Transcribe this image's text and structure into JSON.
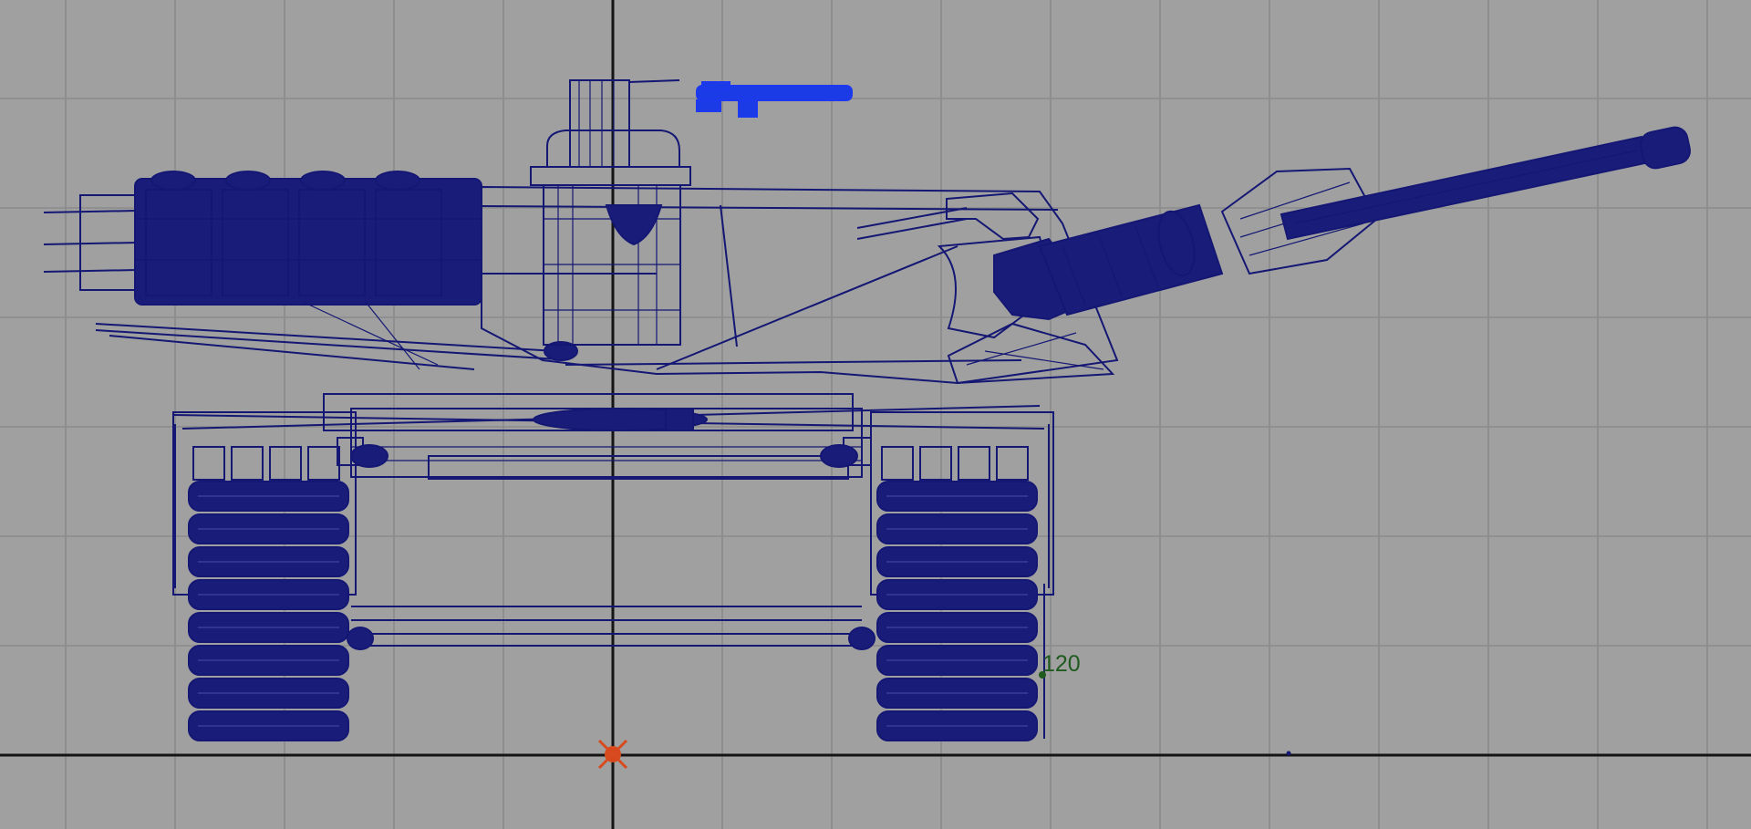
{
  "viewport": {
    "view": "front",
    "show_grid": true,
    "background_color": "#a0a0a0",
    "wireframe_color": "#141773",
    "selection_color": "#1e38f0",
    "pivot_color": "#d84a1e"
  },
  "annotations": [
    {
      "id": "measure-label",
      "text": "120",
      "color": "#1f5a1f"
    }
  ]
}
